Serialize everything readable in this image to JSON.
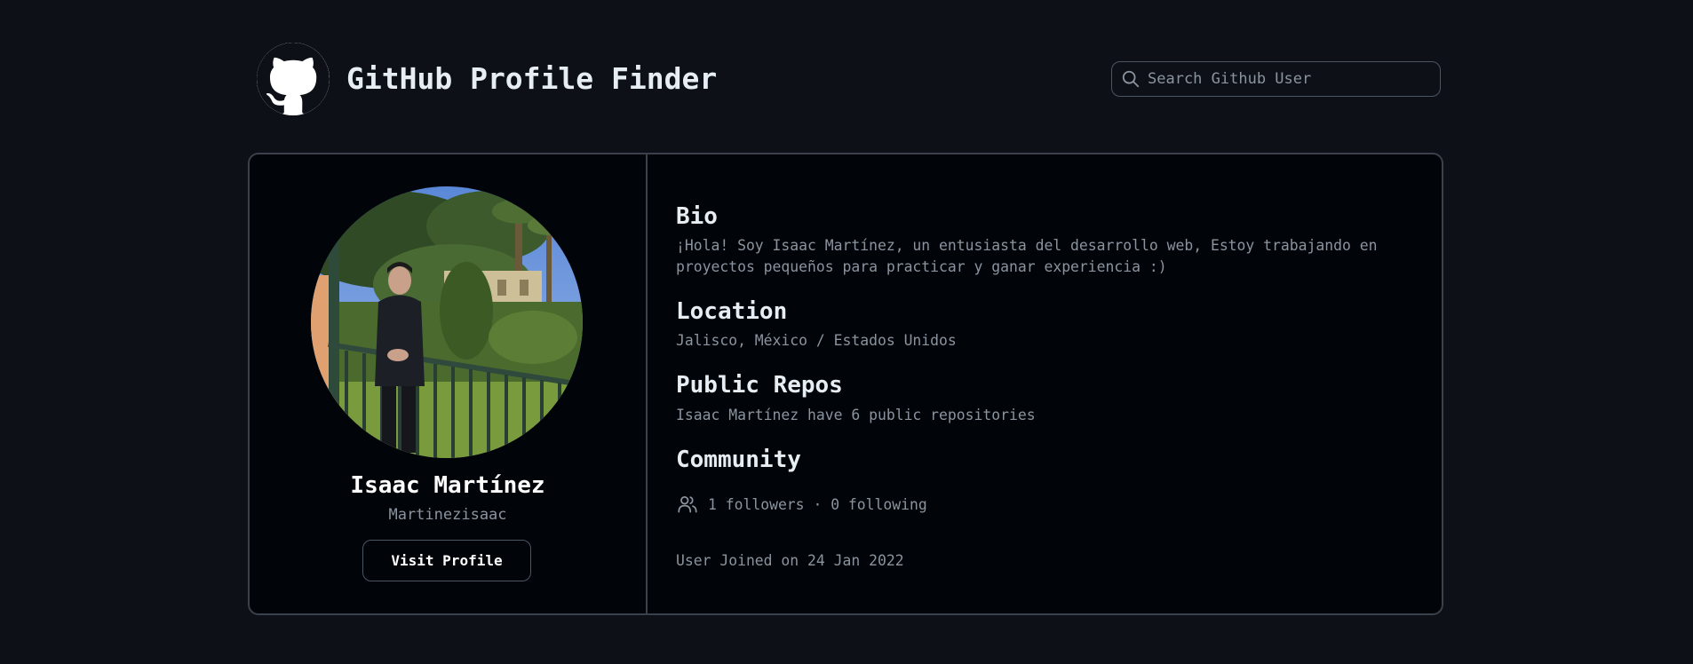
{
  "header": {
    "logo_icon": "github-octocat-icon",
    "title": "GitHub Profile Finder",
    "search": {
      "placeholder": "Search Github User",
      "value": "",
      "icon": "search-icon"
    }
  },
  "profile": {
    "avatar_icon": "user-avatar-photo",
    "name": "Isaac Martínez",
    "login": "Martinezisaac",
    "visit_button_label": "Visit Profile"
  },
  "details": {
    "bio": {
      "heading": "Bio",
      "line1": "¡Hola! Soy Isaac Martínez, un entusiasta del desarrollo web, Estoy trabajando en",
      "line2": "proyectos pequeños para practicar y ganar experiencia :)"
    },
    "location": {
      "heading": "Location",
      "value": "Jalisco, México / Estados Unidos"
    },
    "repos": {
      "heading": "Public Repos",
      "value": "Isaac Martínez have 6 public repositories"
    },
    "community": {
      "heading": "Community",
      "icon": "users-icon",
      "followers": "1 followers",
      "separator": "·",
      "following": "0 following"
    },
    "joined": "User Joined on 24 Jan 2022"
  },
  "colors": {
    "background": "#0d1117",
    "card_background": "#010409",
    "border": "#3b414a",
    "heading_text": "#e6edf3",
    "muted_text": "#8b949e"
  }
}
